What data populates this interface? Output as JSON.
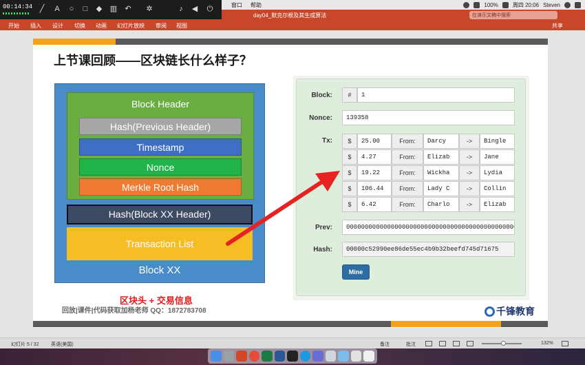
{
  "recorder": {
    "timer": "00:14:34"
  },
  "menubar": {
    "items": [
      "窗口",
      "帮助"
    ],
    "battery": "100%",
    "clock": "周四 20:06",
    "user": "Steven"
  },
  "titlebar": {
    "doc_title": "day04_默克尔根及其生成算法",
    "search_placeholder": "在演示文稿中搜索"
  },
  "ribbon": {
    "tabs": [
      "开始",
      "插入",
      "设计",
      "切换",
      "动画",
      "幻灯片放映",
      "审阅",
      "视图"
    ],
    "share": "共享"
  },
  "slide": {
    "title": "上节课回顾——区块链长什么样子？",
    "block": {
      "header_title": "Block Header",
      "rows": [
        "Hash(Previous Header)",
        "Timestamp",
        "Nonce",
        "Merkle Root Hash"
      ],
      "block_hash": "Hash(Block XX Header)",
      "tx_list": "Transaction List",
      "name": "Block XX"
    },
    "note_red": "区块头 + 交易信息",
    "note": "回放|课件|代码获取加杨老师 QQ：1872783708",
    "logo_text": "千锋教育"
  },
  "demo": {
    "block_label": "Block:",
    "block_prefix": "#",
    "block_value": "1",
    "nonce_label": "Nonce:",
    "nonce_value": "139358",
    "tx_label": "Tx:",
    "tx": [
      {
        "cur": "$",
        "amount": "25.00",
        "from_label": "From:",
        "from": "Darcy",
        "arrow": "->",
        "to": "Bingle"
      },
      {
        "cur": "$",
        "amount": "4.27",
        "from_label": "From:",
        "from": "Elizab",
        "arrow": "->",
        "to": "Jane"
      },
      {
        "cur": "$",
        "amount": "19.22",
        "from_label": "From:",
        "from": "Wickha",
        "arrow": "->",
        "to": "Lydia"
      },
      {
        "cur": "$",
        "amount": "106.44",
        "from_label": "From:",
        "from": "Lady C",
        "arrow": "->",
        "to": "Collin"
      },
      {
        "cur": "$",
        "amount": "6.42",
        "from_label": "From:",
        "from": "Charlo",
        "arrow": "->",
        "to": "Elizab"
      }
    ],
    "prev_label": "Prev:",
    "prev_value": "0000000000000000000000000000000000000000000000000000000000000000",
    "hash_label": "Hash:",
    "hash_value": "00000c52990ee86de55ec4b9b32beefd745d71675",
    "mine_label": "Mine"
  },
  "statusbar": {
    "slide_pos": "幻灯片 5 / 32",
    "language": "英语(美国)",
    "notes": "备注",
    "comments": "批注",
    "zoom": "132%"
  },
  "colors": {
    "ribbon": "#c8472b",
    "block_bg": "#4a8cc9",
    "header_bg": "#6aae42",
    "row_prev_hash": "#a6a6a6",
    "row_timestamp": "#3f6fc4",
    "row_nonce": "#1fb34a",
    "row_merkle": "#ef7a32",
    "tx_list": "#f7bd25",
    "mine_button": "#2e6da4",
    "arrow": "#e52421"
  }
}
